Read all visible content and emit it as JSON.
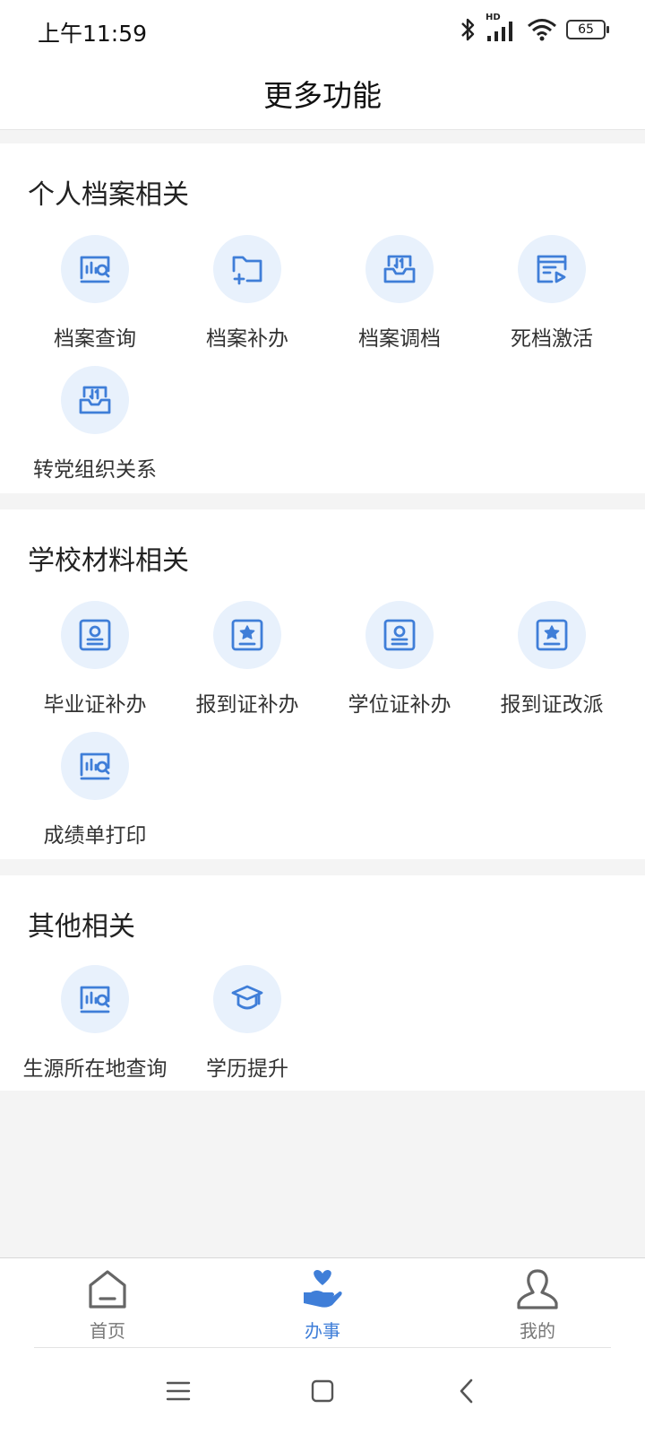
{
  "status": {
    "time": "上午11:59",
    "battery": "65",
    "signal_badge": "HD"
  },
  "header": {
    "title": "更多功能"
  },
  "sections": [
    {
      "title": "个人档案相关",
      "items": [
        {
          "label": "档案查询",
          "icon": "chart-search-icon"
        },
        {
          "label": "档案补办",
          "icon": "folder-add-icon"
        },
        {
          "label": "档案调档",
          "icon": "inbox-transfer-icon"
        },
        {
          "label": "死档激活",
          "icon": "document-play-icon"
        },
        {
          "label": "转党组织关系",
          "icon": "inbox-transfer-icon"
        }
      ]
    },
    {
      "title": "学校材料相关",
      "items": [
        {
          "label": "毕业证补办",
          "icon": "certificate-person-icon"
        },
        {
          "label": "报到证补办",
          "icon": "certificate-star-icon"
        },
        {
          "label": "学位证补办",
          "icon": "certificate-person-icon"
        },
        {
          "label": "报到证改派",
          "icon": "certificate-star-icon"
        },
        {
          "label": "成绩单打印",
          "icon": "chart-search-icon"
        }
      ]
    },
    {
      "title": "其他相关",
      "items": [
        {
          "label": "生源所在地查询",
          "icon": "chart-search-icon"
        },
        {
          "label": "学历提升",
          "icon": "graduation-cap-icon"
        }
      ]
    }
  ],
  "tabs": [
    {
      "label": "首页",
      "icon": "home-icon",
      "active": false
    },
    {
      "label": "办事",
      "icon": "hand-heart-icon",
      "active": true
    },
    {
      "label": "我的",
      "icon": "user-icon",
      "active": false
    }
  ],
  "colors": {
    "accent": "#3f7ed8",
    "icon_bg": "#e8f1fc",
    "page_bg": "#f4f4f4"
  }
}
